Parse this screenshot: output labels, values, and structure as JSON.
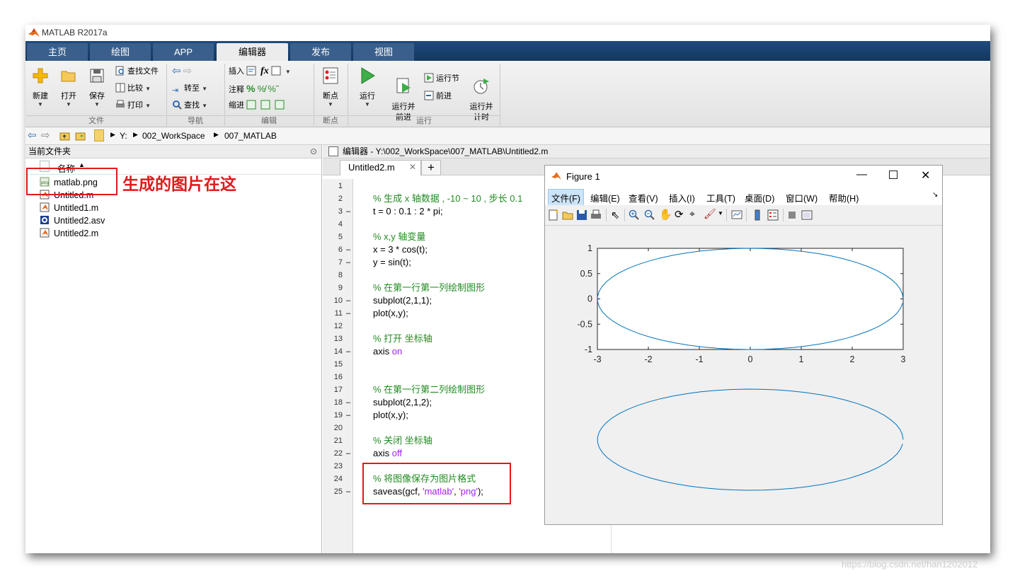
{
  "app": {
    "title": "MATLAB R2017a"
  },
  "tabs": [
    "主页",
    "绘图",
    "APP",
    "编辑器",
    "发布",
    "视图"
  ],
  "ribbon": {
    "file": {
      "new": "新建",
      "open": "打开",
      "save": "保存",
      "find_files": "查找文件",
      "compare": "比较",
      "print": "打印",
      "group": "文件"
    },
    "navigate": {
      "goto": "转至",
      "find": "查找",
      "group": "导航"
    },
    "edit": {
      "insert": "插入",
      "comment": "注释",
      "indent": "缩进",
      "fx": "fx",
      "group": "编辑"
    },
    "breakpoints": {
      "label": "断点",
      "group": "断点"
    },
    "run": {
      "run": "运行",
      "run_advance": "运行并\n前进",
      "run_section": "运行节",
      "advance": "前进",
      "run_time": "运行并\n计时",
      "group": "运行"
    }
  },
  "address": {
    "drive": "Y:",
    "folder1": "002_WorkSpace",
    "folder2": "007_MATLAB"
  },
  "current_folder": {
    "title": "当前文件夹",
    "column": "名称",
    "files": [
      "matlab.png",
      "Untitled.m",
      "Untitled1.m",
      "Untitled2.asv",
      "Untitled2.m"
    ]
  },
  "annotation": "生成的图片在这",
  "editor": {
    "header": "编辑器 - Y:\\002_WorkSpace\\007_MATLAB\\Untitled2.m",
    "tab": "Untitled2.m",
    "lines": [
      {
        "n": "1",
        "d": "",
        "c": ""
      },
      {
        "n": "2",
        "d": "",
        "c": "% 生成 x 轴数据 , -10 ~ 10 , 步长 0.1"
      },
      {
        "n": "3",
        "d": "–",
        "c": "t = 0 : 0.1 : 2 * pi;"
      },
      {
        "n": "4",
        "d": "",
        "c": ""
      },
      {
        "n": "5",
        "d": "",
        "c": "% x,y 轴变量"
      },
      {
        "n": "6",
        "d": "–",
        "c": "x = 3 * cos(t);"
      },
      {
        "n": "7",
        "d": "–",
        "c": "y = sin(t);"
      },
      {
        "n": "8",
        "d": "",
        "c": ""
      },
      {
        "n": "9",
        "d": "",
        "c": "% 在第一行第一列绘制图形"
      },
      {
        "n": "10",
        "d": "–",
        "c": "subplot(2,1,1);"
      },
      {
        "n": "11",
        "d": "–",
        "c": "plot(x,y);"
      },
      {
        "n": "12",
        "d": "",
        "c": ""
      },
      {
        "n": "13",
        "d": "",
        "c": "% 打开 坐标轴"
      },
      {
        "n": "14",
        "d": "–",
        "c": "axis on"
      },
      {
        "n": "15",
        "d": "",
        "c": ""
      },
      {
        "n": "16",
        "d": "",
        "c": ""
      },
      {
        "n": "17",
        "d": "",
        "c": "% 在第一行第二列绘制图形"
      },
      {
        "n": "18",
        "d": "–",
        "c": "subplot(2,1,2);"
      },
      {
        "n": "19",
        "d": "–",
        "c": "plot(x,y);"
      },
      {
        "n": "20",
        "d": "",
        "c": ""
      },
      {
        "n": "21",
        "d": "",
        "c": "% 关闭 坐标轴"
      },
      {
        "n": "22",
        "d": "–",
        "c": "axis off"
      },
      {
        "n": "23",
        "d": "",
        "c": ""
      },
      {
        "n": "24",
        "d": "",
        "c": "% 将图像保存为图片格式"
      },
      {
        "n": "25",
        "d": "–",
        "c": "saveas(gcf, 'matlab', 'png');"
      }
    ]
  },
  "figure": {
    "title": "Figure 1",
    "menu": [
      "文件(F)",
      "编辑(E)",
      "查看(V)",
      "插入(I)",
      "工具(T)",
      "桌面(D)",
      "窗口(W)",
      "帮助(H)"
    ],
    "xticks": [
      "-3",
      "-2",
      "-1",
      "0",
      "1",
      "2",
      "3"
    ],
    "yticks": [
      "1",
      "0.5",
      "0",
      "-0.5",
      "-1"
    ],
    "line_color": "#0072bd"
  },
  "chart_data": {
    "type": "line",
    "series": [
      {
        "x_expr": "3*cos(t)",
        "y_expr": "sin(t)",
        "t_range": [
          0,
          6.2
        ],
        "t_step": 0.1
      }
    ],
    "xlim": [
      -3,
      3
    ],
    "ylim": [
      -1,
      1
    ]
  },
  "watermark": "https://blog.csdn.net/han1202012"
}
